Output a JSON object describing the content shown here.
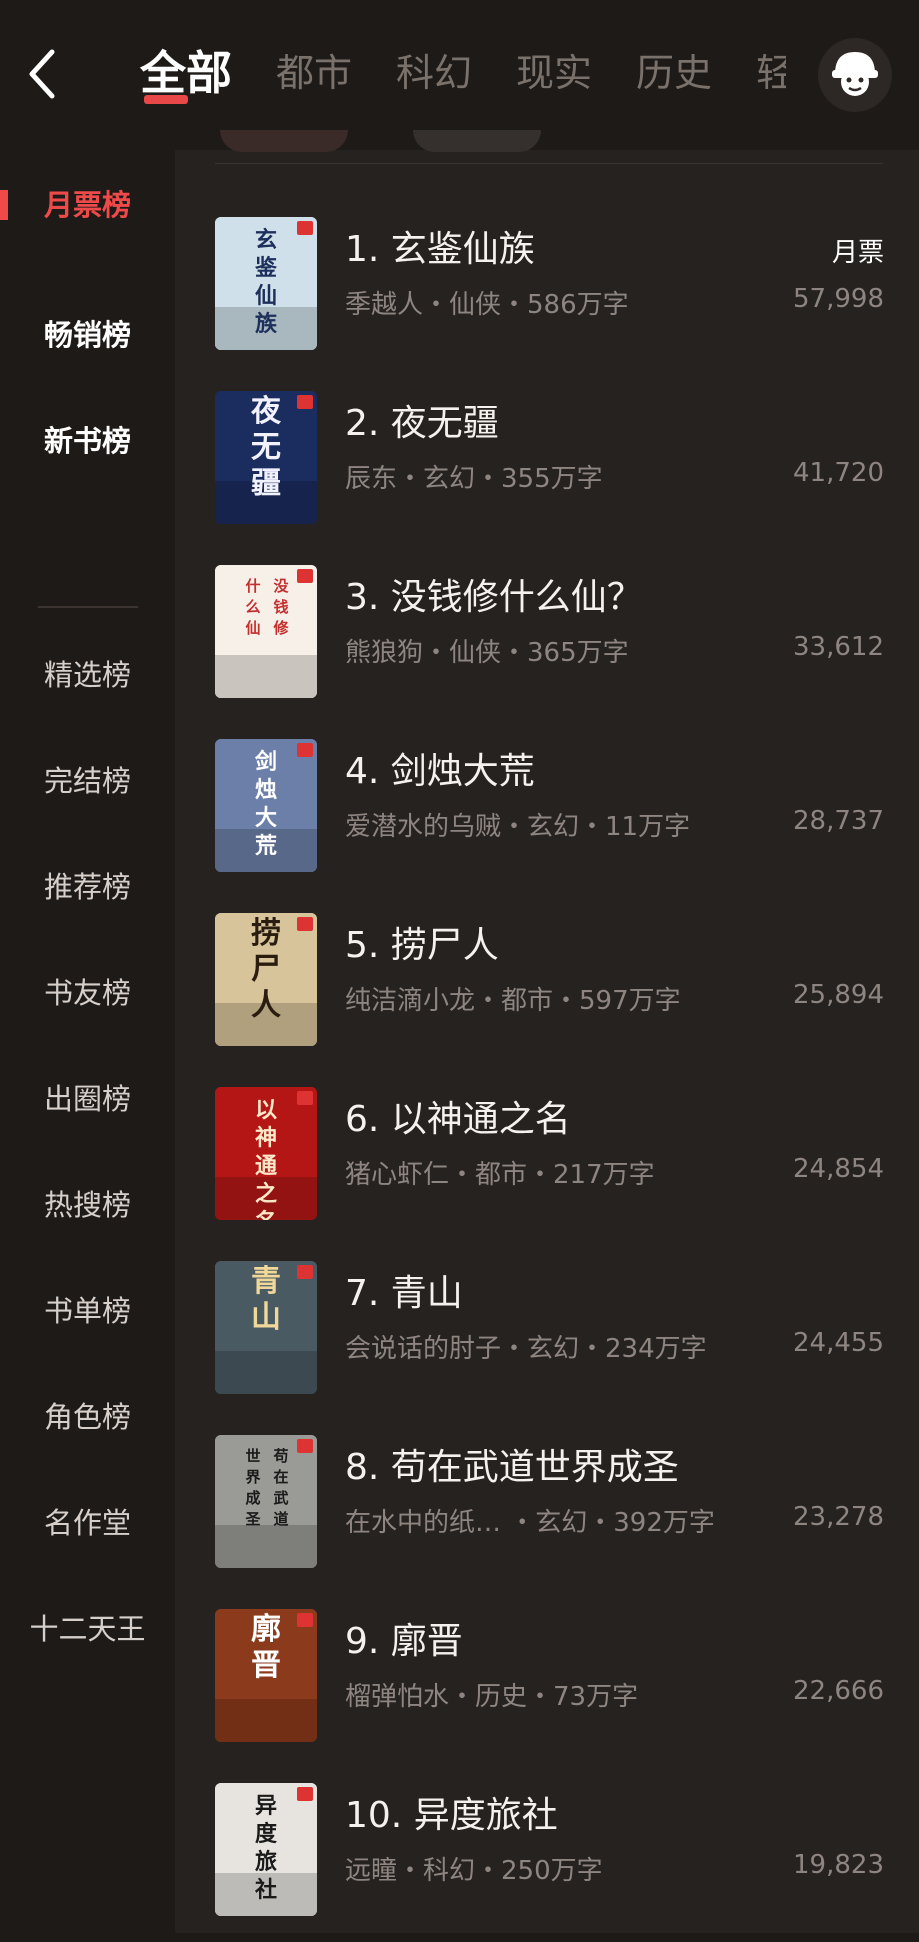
{
  "header": {
    "tabs": [
      {
        "label": "全部",
        "active": true
      },
      {
        "label": "都市",
        "active": false
      },
      {
        "label": "科幻",
        "active": false
      },
      {
        "label": "现实",
        "active": false
      },
      {
        "label": "历史",
        "active": false
      },
      {
        "label": "轻",
        "active": false
      }
    ],
    "accent": "#e84848"
  },
  "sidebar": {
    "items": [
      {
        "label": "月票榜",
        "state": "active"
      },
      {
        "label": "畅销榜",
        "state": "bold"
      },
      {
        "label": "新书榜",
        "state": "bold"
      },
      {
        "label": "精选榜",
        "state": "normal"
      },
      {
        "label": "完结榜",
        "state": "normal"
      },
      {
        "label": "推荐榜",
        "state": "normal"
      },
      {
        "label": "书友榜",
        "state": "normal"
      },
      {
        "label": "出圈榜",
        "state": "normal"
      },
      {
        "label": "热搜榜",
        "state": "normal"
      },
      {
        "label": "书单榜",
        "state": "normal"
      },
      {
        "label": "角色榜",
        "state": "normal"
      },
      {
        "label": "名作堂",
        "state": "normal"
      },
      {
        "label": "十二天王",
        "state": "normal"
      }
    ]
  },
  "list": {
    "count_label": "月票",
    "books": [
      {
        "title": "1. 玄鉴仙族",
        "meta": "季越人・仙侠・586万字",
        "count": "57,998",
        "cover_text": "玄鉴仙族",
        "cover_bg": "#cfe0ea",
        "cover_fg": "#1d2f5b"
      },
      {
        "title": "2. 夜无疆",
        "meta": "辰东・玄幻・355万字",
        "count": "41,720",
        "cover_text": "夜无疆",
        "cover_bg": "#1b2d5e",
        "cover_fg": "#f2f2ff"
      },
      {
        "title": "3. 没钱修什么仙？",
        "meta": "熊狼狗・仙侠・365万字",
        "count": "33,612",
        "cover_text": "没钱修什么仙",
        "cover_bg": "#f6f0e8",
        "cover_fg": "#c23030"
      },
      {
        "title": "4. 剑烛大荒",
        "meta": "爱潜水的乌贼・玄幻・11万字",
        "count": "28,737",
        "cover_text": "剑烛大荒",
        "cover_bg": "#6c7fa8",
        "cover_fg": "#ffffff"
      },
      {
        "title": "5. 捞尸人",
        "meta": "纯洁滴小龙・都市・597万字",
        "count": "25,894",
        "cover_text": "捞尸人",
        "cover_bg": "#d8c49a",
        "cover_fg": "#2a1d10"
      },
      {
        "title": "6. 以神通之名",
        "meta": "猪心虾仁・都市・217万字",
        "count": "24,854",
        "cover_text": "以神通之名",
        "cover_bg": "#b41616",
        "cover_fg": "#ffe9c9"
      },
      {
        "title": "7. 青山",
        "meta": "会说话的肘子・玄幻・234万字",
        "count": "24,455",
        "cover_text": "青山",
        "cover_bg": "#4a5a63",
        "cover_fg": "#f0d79a"
      },
      {
        "title": "8. 苟在武道世界成圣",
        "meta": "在水中的纸…  ・玄幻・392万字",
        "count": "23,278",
        "cover_text": "苟在武道世界成圣",
        "cover_bg": "#9a9a96",
        "cover_fg": "#1a1a1a"
      },
      {
        "title": "9. 廓晋",
        "meta": "榴弹怕水・历史・73万字",
        "count": "22,666",
        "cover_text": "廓晋",
        "cover_bg": "#8c3a1c",
        "cover_fg": "#ffffff"
      },
      {
        "title": "10. 异度旅社",
        "meta": "远瞳・科幻・250万字",
        "count": "19,823",
        "cover_text": "异度旅社",
        "cover_bg": "#e7e4e0",
        "cover_fg": "#1a1a1a"
      }
    ]
  }
}
